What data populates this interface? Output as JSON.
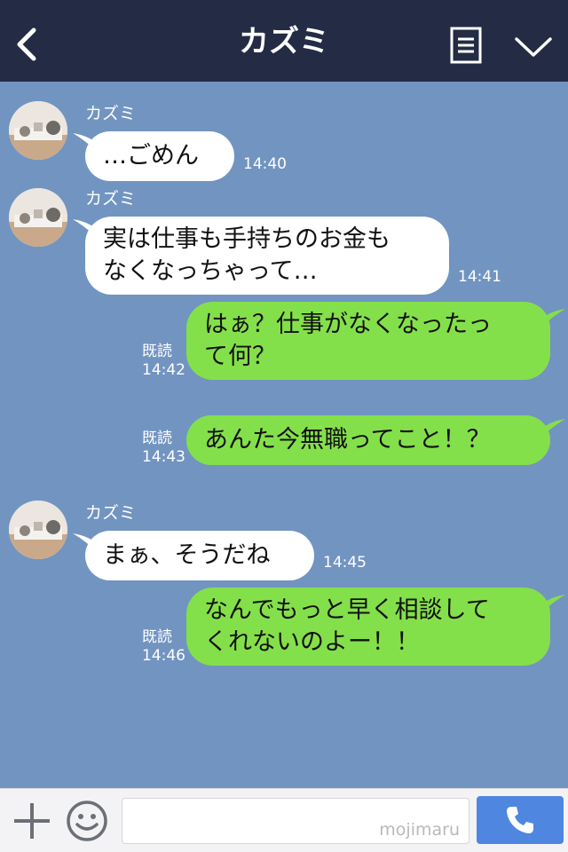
{
  "header": {
    "title": "カズミ",
    "back_icon": "chevron-left-icon",
    "menu_icon": "note-icon",
    "expand_icon": "chevron-down-icon"
  },
  "colors": {
    "header_bg": "#232c44",
    "chat_bg": "#7294c1",
    "incoming_bubble": "#ffffff",
    "outgoing_bubble": "#84e04a",
    "call_button": "#4f86e0"
  },
  "messages": [
    {
      "direction": "in",
      "sender": "カズミ",
      "text": "…ごめん",
      "time": "14:40"
    },
    {
      "direction": "in",
      "sender": "カズミ",
      "text": "実は仕事も手持ちのお金も\nなくなっちゃって…",
      "time": "14:41"
    },
    {
      "direction": "out",
      "read": "既読",
      "text": "はぁ？仕事がなくなったっ\nて何？",
      "time": "14:42"
    },
    {
      "direction": "out",
      "read": "既読",
      "text": "あんた今無職ってこと！？",
      "time": "14:43"
    },
    {
      "direction": "in",
      "sender": "カズミ",
      "text": "まぁ、そうだね",
      "time": "14:45"
    },
    {
      "direction": "out",
      "read": "既読",
      "text": "なんでもっと早く相談して\nくれないのよー！！",
      "time": "14:46"
    }
  ],
  "footer": {
    "plus_icon": "plus-icon",
    "emoji_icon": "smile-icon",
    "input_watermark": "mojimaru",
    "call_icon": "phone-icon"
  }
}
